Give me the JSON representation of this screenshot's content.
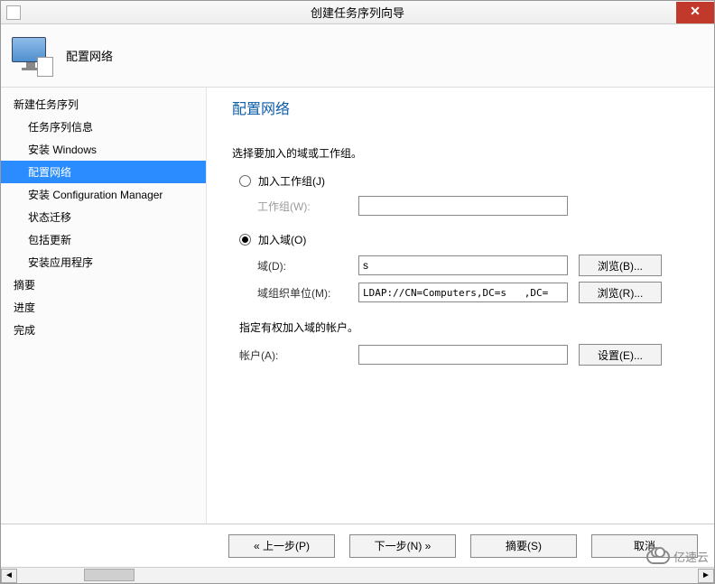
{
  "window": {
    "title": "创建任务序列向导"
  },
  "header": {
    "subtitle": "配置网络"
  },
  "sidebar": {
    "groups": [
      {
        "label": "新建任务序列",
        "items": [
          {
            "label": "任务序列信息"
          },
          {
            "label": "安装 Windows"
          },
          {
            "label": "配置网络",
            "selected": true
          },
          {
            "label": "安装 Configuration Manager"
          },
          {
            "label": "状态迁移"
          },
          {
            "label": "包括更新"
          },
          {
            "label": "安装应用程序"
          }
        ]
      },
      {
        "label": "摘要",
        "items": []
      },
      {
        "label": "进度",
        "items": []
      },
      {
        "label": "完成",
        "items": []
      }
    ]
  },
  "content": {
    "title": "配置网络",
    "intro": "选择要加入的域或工作组。",
    "workgroup": {
      "radio_label": "加入工作组(J)",
      "field_label": "工作组(W):",
      "value": ""
    },
    "domain": {
      "radio_label": "加入域(O)",
      "domain_field_label": "域(D):",
      "domain_value": "s",
      "ou_field_label": "域组织单位(M):",
      "ou_value": "LDAP://CN=Computers,DC=s   ,DC=   ,",
      "browse_b": "浏览(B)...",
      "browse_r": "浏览(R)..."
    },
    "account": {
      "note": "指定有权加入域的帐户。",
      "field_label": "帐户(A):",
      "value": "",
      "set_btn": "设置(E)..."
    }
  },
  "footer": {
    "prev": "« 上一步(P)",
    "next": "下一步(N) »",
    "summary": "摘要(S)",
    "cancel": "取消"
  },
  "watermark": "亿速云"
}
